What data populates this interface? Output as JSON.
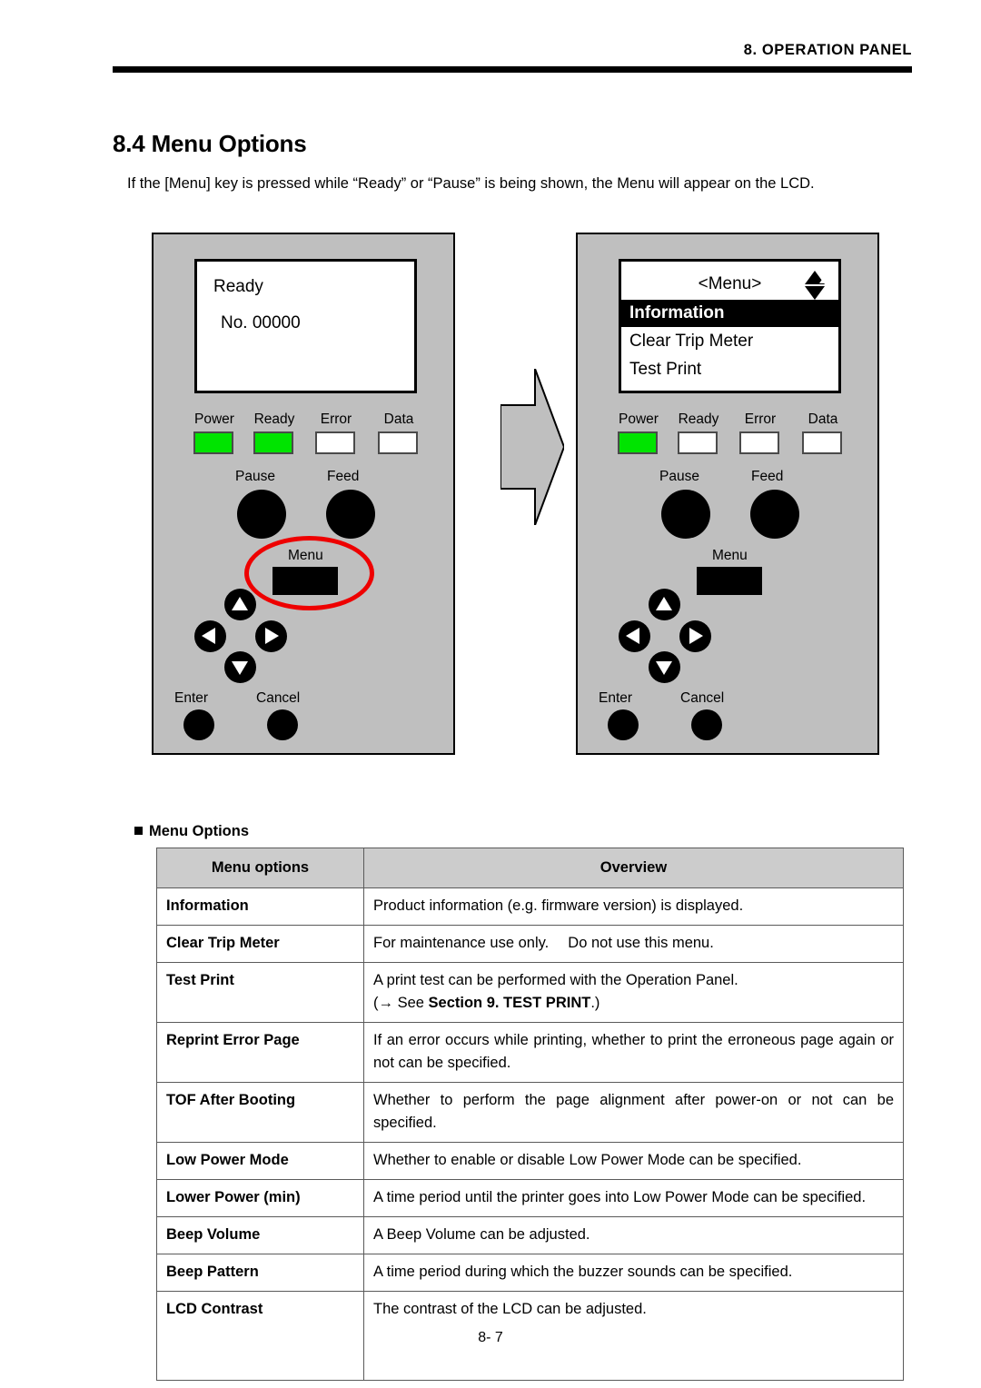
{
  "header": {
    "running_head": "8. OPERATION PANEL"
  },
  "section": {
    "title": "8.4 Menu Options",
    "intro": "If the [Menu] key is pressed while “Ready” or “Pause” is being shown, the Menu will appear on the LCD."
  },
  "panel_left": {
    "lcd": {
      "line1": "Ready",
      "line2": "No. 00000"
    },
    "leds": [
      {
        "label": "Power",
        "state": "on"
      },
      {
        "label": "Ready",
        "state": "on"
      },
      {
        "label": "Error",
        "state": "off"
      },
      {
        "label": "Data",
        "state": "off"
      }
    ],
    "buttons": {
      "pause": "Pause",
      "feed": "Feed",
      "menu": "Menu",
      "enter": "Enter",
      "cancel": "Cancel"
    },
    "highlight_color": "#ee0000"
  },
  "panel_right": {
    "lcd": {
      "title": "<Menu>",
      "items": [
        {
          "label": "Information",
          "selected": true
        },
        {
          "label": "Clear Trip Meter",
          "selected": false
        },
        {
          "label": "Test Print",
          "selected": false
        }
      ],
      "scroll_arrows": "up-down-scroll-icon"
    },
    "leds": [
      {
        "label": "Power",
        "state": "on"
      },
      {
        "label": "Ready",
        "state": "off"
      },
      {
        "label": "Error",
        "state": "off"
      },
      {
        "label": "Data",
        "state": "off"
      }
    ],
    "buttons": {
      "pause": "Pause",
      "feed": "Feed",
      "menu": "Menu",
      "enter": "Enter",
      "cancel": "Cancel"
    }
  },
  "table_section": {
    "caption": "Menu Options",
    "headers": {
      "col1": "Menu options",
      "col2": "Overview"
    },
    "rows": [
      {
        "option": "Information",
        "overview": "Product information (e.g. firmware version) is displayed."
      },
      {
        "option": "Clear Trip Meter",
        "overview": "For maintenance use only.　 Do not use this menu."
      },
      {
        "option": "Test Print",
        "overview": "A print test can be performed with the Operation Panel.",
        "reference_prefix": "(→ See ",
        "reference_bold": "Section 9. TEST PRINT",
        "reference_suffix": ".)"
      },
      {
        "option": "Reprint Error Page",
        "overview": "If an error occurs while printing, whether to print the erroneous page again or not can be specified."
      },
      {
        "option": "TOF After Booting",
        "overview": "Whether to perform the page alignment after power-on or not can be specified."
      },
      {
        "option": "Low Power Mode",
        "overview": "Whether to enable or disable Low Power Mode can be specified."
      },
      {
        "option": "Lower Power (min)",
        "overview": "A time period until the printer goes into Low Power Mode can be specified."
      },
      {
        "option": "Beep Volume",
        "overview": "A Beep Volume can be adjusted."
      },
      {
        "option": "Beep Pattern",
        "overview": "A time period during which the buzzer sounds can be specified."
      },
      {
        "option": "LCD Contrast",
        "overview": "The contrast of the LCD can be adjusted."
      }
    ]
  },
  "footer": {
    "page_number": "8- 7"
  }
}
